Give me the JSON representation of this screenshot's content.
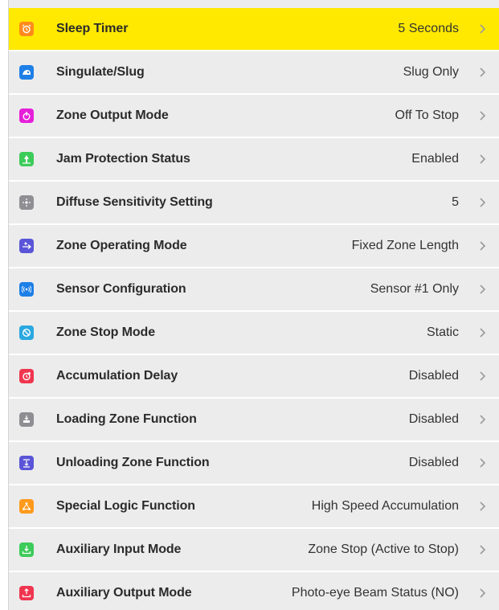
{
  "settings": {
    "items": [
      {
        "label": "Sleep Timer",
        "value": "5 Seconds",
        "icon": "alarm-clock-icon",
        "color": "#ff8a1c",
        "highlighted": true
      },
      {
        "label": "Singulate/Slug",
        "value": "Slug Only",
        "icon": "slug-icon",
        "color": "#1e7fe6",
        "highlighted": false
      },
      {
        "label": "Zone Output Mode",
        "value": "Off To Stop",
        "icon": "power-output-icon",
        "color": "#e620d9",
        "highlighted": false
      },
      {
        "label": "Jam Protection Status",
        "value": "Enabled",
        "icon": "jam-protection-icon",
        "color": "#3dcb5a",
        "highlighted": false
      },
      {
        "label": "Diffuse Sensitivity Setting",
        "value": "5",
        "icon": "sensitivity-icon",
        "color": "#8e8e93",
        "highlighted": false
      },
      {
        "label": "Zone Operating Mode",
        "value": "Fixed Zone Length",
        "icon": "zone-mode-icon",
        "color": "#5a55d8",
        "highlighted": false
      },
      {
        "label": "Sensor Configuration",
        "value": "Sensor #1 Only",
        "icon": "sensor-icon",
        "color": "#1e7fe6",
        "highlighted": false
      },
      {
        "label": "Zone Stop Mode",
        "value": "Static",
        "icon": "stop-icon",
        "color": "#2aa8e0",
        "highlighted": false
      },
      {
        "label": "Accumulation Delay",
        "value": "Disabled",
        "icon": "delay-clock-icon",
        "color": "#f0364f",
        "highlighted": false
      },
      {
        "label": "Loading Zone Function",
        "value": "Disabled",
        "icon": "loading-zone-icon",
        "color": "#8e8e93",
        "highlighted": false
      },
      {
        "label": "Unloading Zone Function",
        "value": "Disabled",
        "icon": "unloading-zone-icon",
        "color": "#5a55d8",
        "highlighted": false
      },
      {
        "label": "Special Logic Function",
        "value": "High Speed Accumulation",
        "icon": "logic-tree-icon",
        "color": "#ff9a1c",
        "highlighted": false
      },
      {
        "label": "Auxiliary Input Mode",
        "value": "Zone Stop (Active to Stop)",
        "icon": "input-tray-icon",
        "color": "#3dcb5a",
        "highlighted": false
      },
      {
        "label": "Auxiliary Output Mode",
        "value": "Photo-eye Beam Status (NO)",
        "icon": "output-tray-icon",
        "color": "#f0364f",
        "highlighted": false
      }
    ]
  }
}
